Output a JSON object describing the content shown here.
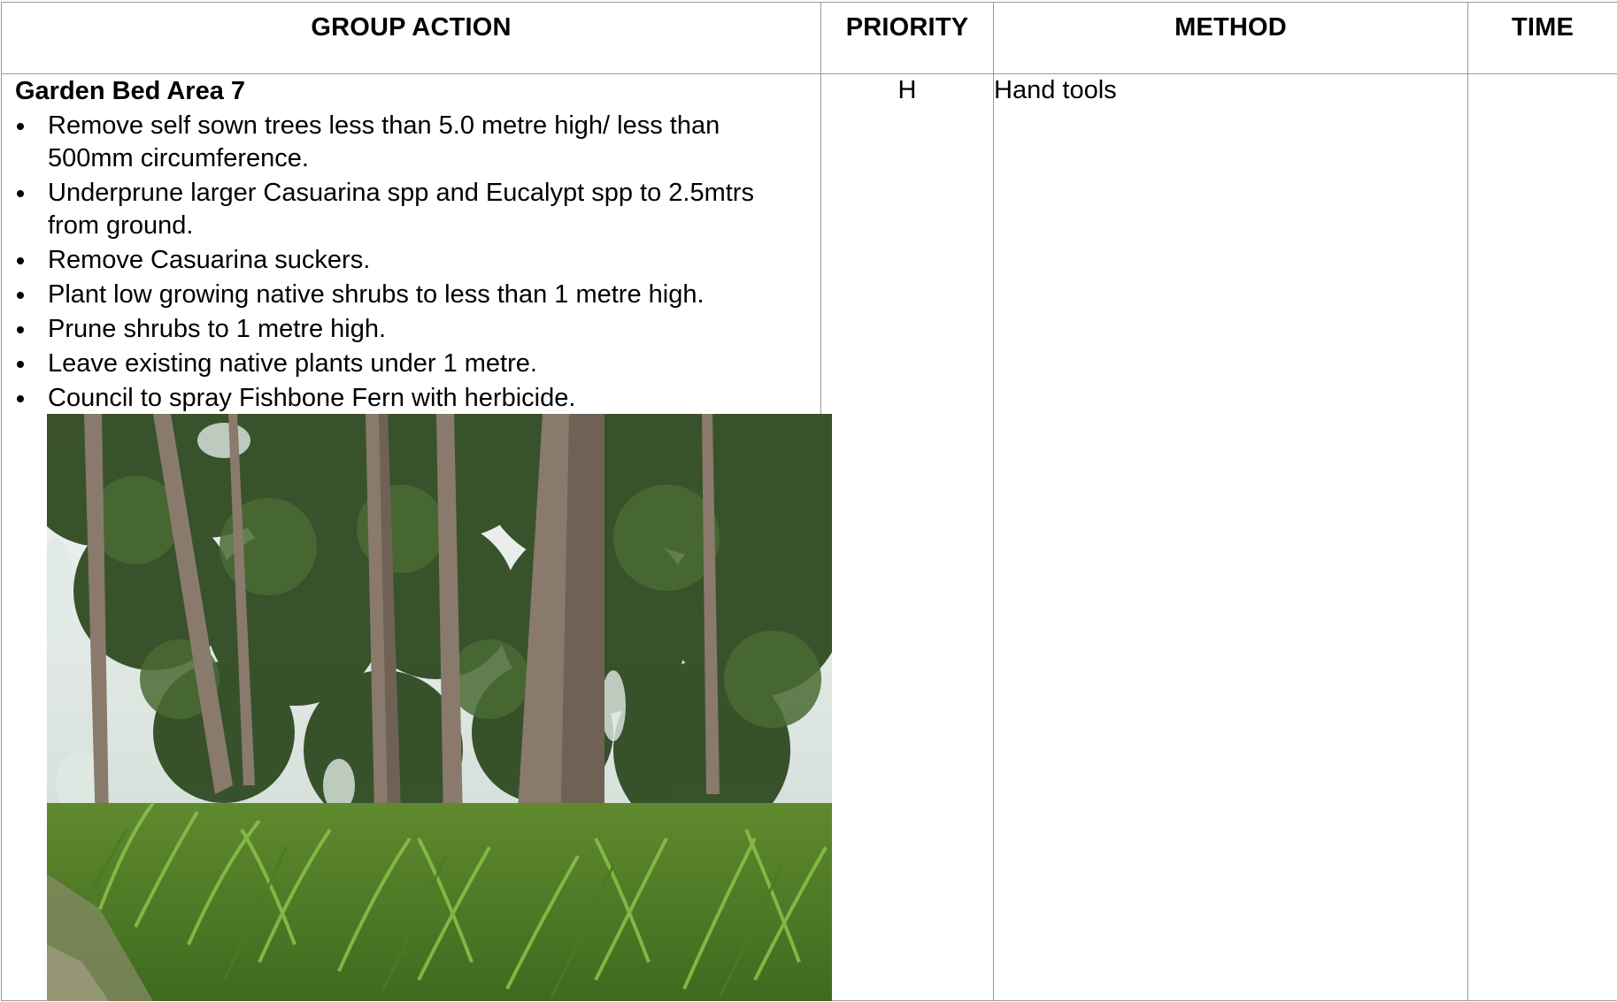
{
  "table": {
    "headers": {
      "group_action": "GROUP ACTION",
      "priority": "PRIORITY",
      "method": "METHOD",
      "time": "TIME"
    },
    "rows": [
      {
        "title": "Garden Bed Area 7",
        "bullets": [
          "Remove self sown trees less than 5.0 metre high/ less than 500mm circumference.",
          "Underprune larger Casuarina spp and Eucalypt spp to 2.5mtrs from ground.",
          "Remove Casuarina suckers.",
          "Plant low growing native shrubs to less than 1 metre high.",
          "Prune shrubs to 1 metre high.",
          "Leave existing native plants under 1 metre.",
          "Council to spray Fishbone Fern with herbicide."
        ],
        "priority": "H",
        "method": "Hand tools",
        "time": ""
      }
    ]
  },
  "colors": {
    "border": "#9a9a9a",
    "text": "#000000",
    "foliage_dark": "#2f4a22",
    "foliage_light": "#6b9a3a",
    "sky": "#e8eef0",
    "trunk": "#7a6a5e"
  },
  "icons": {
    "bullet": "bullet-dot-icon"
  }
}
